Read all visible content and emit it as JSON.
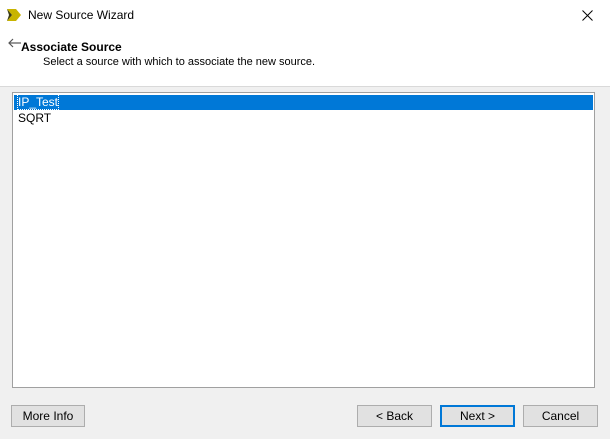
{
  "window": {
    "title": "New Source Wizard",
    "close_glyph": "✕"
  },
  "header": {
    "title": "Associate Source",
    "subtitle": "Select a source with which to associate the new source."
  },
  "list": {
    "items": [
      {
        "label": "IP_Test",
        "selected": true
      },
      {
        "label": "SQRT",
        "selected": false
      }
    ]
  },
  "buttons": {
    "more_info": "More Info",
    "back": "< Back",
    "next": "Next >",
    "cancel": "Cancel"
  },
  "colors": {
    "selection": "#0078d7",
    "logo_primary": "#c8b400",
    "logo_dark": "#3a3a10"
  }
}
